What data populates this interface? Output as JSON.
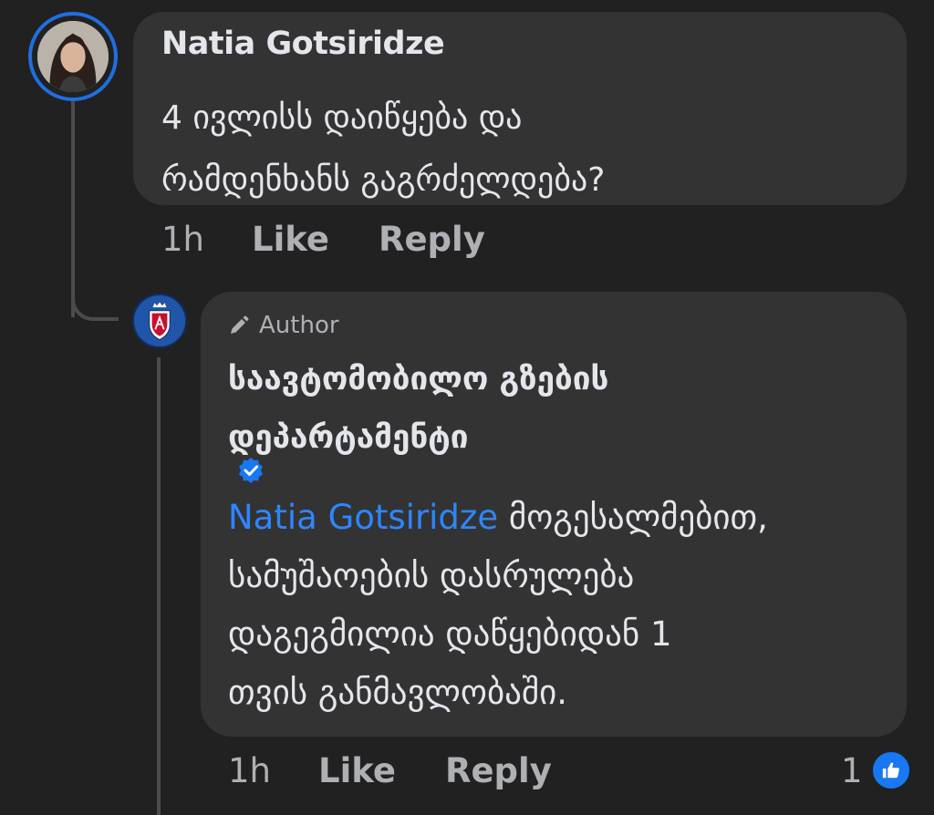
{
  "comment": {
    "author": "Natia Gotsiridze",
    "text_lines": [
      "4 ივლისს დაიწყება და",
      "რამდენხანს გაგრძელდება?"
    ],
    "time": "1h",
    "like_label": "Like",
    "reply_label": "Reply"
  },
  "reply": {
    "badge_label": "Author",
    "author_lines": [
      "საავტომობილო გზების",
      "დეპარტამენტი"
    ],
    "mention": "Natia Gotsiridze",
    "text_first": " მოგესალმებით,",
    "text_lines": [
      "სამუშაოების დასრულება",
      "დაგეგმილია დაწყებიდან 1",
      "თვის განმავლობაში."
    ],
    "time": "1h",
    "like_label": "Like",
    "reply_label": "Reply",
    "reaction_count": "1",
    "reaction_icon": "thumbs-up-icon"
  },
  "colors": {
    "background": "#212122",
    "bubble": "#333334",
    "mention": "#2d86ff",
    "like": "#1877f2"
  }
}
